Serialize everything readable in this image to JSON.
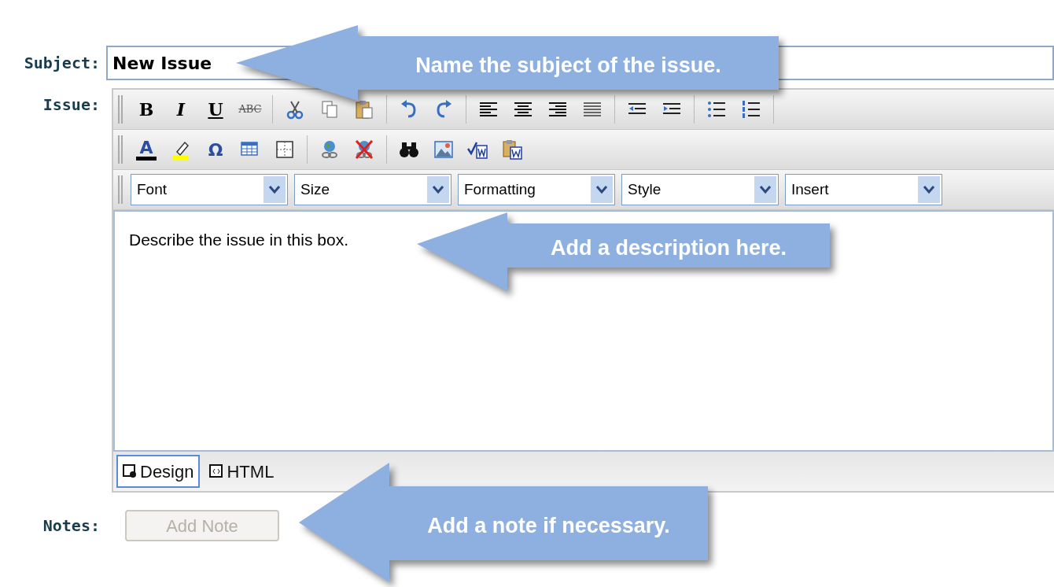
{
  "subject": {
    "label": "Subject:",
    "value": "New Issue"
  },
  "issue": {
    "label": "Issue:",
    "format_buttons": [
      {
        "kind": "bold",
        "label": "B"
      },
      {
        "kind": "italic",
        "label": "I"
      },
      {
        "kind": "underline",
        "label": "U"
      },
      {
        "kind": "strike",
        "label": "ABC"
      }
    ],
    "font_color_glyph": "A",
    "symbol_glyph": "Ω",
    "dropdowns": [
      "Font",
      "Size",
      "Formatting",
      "Style",
      "Insert"
    ],
    "content": "Describe the issue in this box.",
    "modes": [
      {
        "label": "Design",
        "selected": true
      },
      {
        "label": "HTML",
        "selected": false
      }
    ]
  },
  "notes": {
    "label": "Notes:",
    "button": "Add Note",
    "disabled": true
  },
  "callouts": [
    "Name the subject of the issue.",
    "Add a description here.",
    "Add a note if necessary."
  ]
}
